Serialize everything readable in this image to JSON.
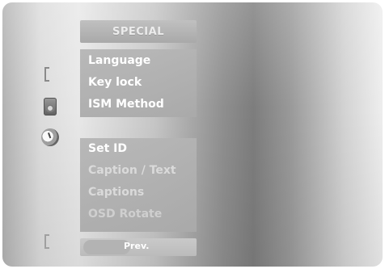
{
  "menu": {
    "title": "SPECIAL",
    "top_items": [
      {
        "label": "Language"
      },
      {
        "label": "Key lock"
      },
      {
        "label": "ISM Method"
      }
    ],
    "bottom_items": [
      {
        "label": "Set ID"
      },
      {
        "label": "Caption / Text"
      },
      {
        "label": "Captions"
      },
      {
        "label": "OSD Rotate"
      }
    ]
  },
  "footer": {
    "prev_label": "Prev."
  },
  "icons": [
    "bracket-icon",
    "speaker-icon",
    "clock-icon",
    "bracket-icon"
  ]
}
